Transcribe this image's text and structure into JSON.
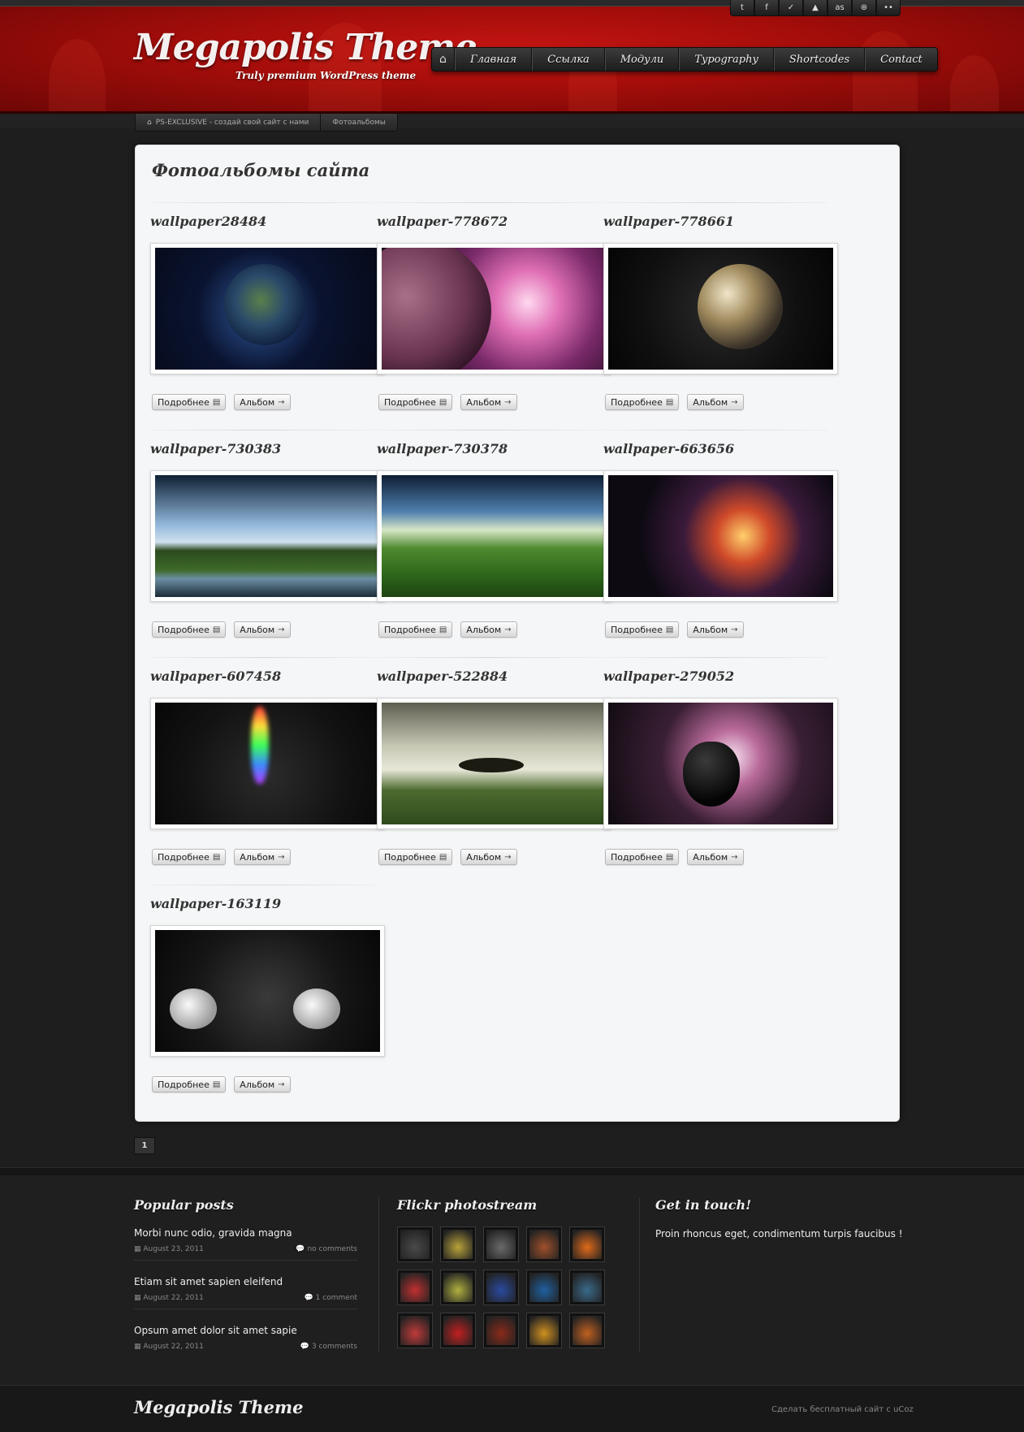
{
  "social": {
    "items": [
      {
        "icon": "tumblr-icon",
        "glyph": "t"
      },
      {
        "icon": "facebook-icon",
        "glyph": "f"
      },
      {
        "icon": "twitter-icon",
        "glyph": "✓"
      },
      {
        "icon": "deviantart-icon",
        "glyph": "▲"
      },
      {
        "icon": "lastfm-icon",
        "glyph": "as"
      },
      {
        "icon": "dribbble-icon",
        "glyph": "⊛"
      },
      {
        "icon": "flickr-icon",
        "glyph": "••"
      }
    ]
  },
  "header": {
    "logo": "Megapolis Theme",
    "tagline": "Truly premium WordPress theme"
  },
  "nav": {
    "home_glyph": "⌂",
    "items": [
      "Главная",
      "Ссылка",
      "Модули",
      "Typography",
      "Shortcodes",
      "Contact"
    ]
  },
  "breadcrumb": {
    "home_glyph": "⌂",
    "site": "PS-EXCLUSIVE - создай свой сайт с нами",
    "current": "Фотоальбомы"
  },
  "main": {
    "title": "Фотоальбомы сайта",
    "more_label": "Подробнее",
    "more_glyph": "▤",
    "album_label": "Альбом",
    "album_glyph": "→",
    "albums": [
      {
        "title": "wallpaper28484"
      },
      {
        "title": "wallpaper-778672"
      },
      {
        "title": "wallpaper-778661"
      },
      {
        "title": "wallpaper-730383"
      },
      {
        "title": "wallpaper-730378"
      },
      {
        "title": "wallpaper-663656"
      },
      {
        "title": "wallpaper-607458"
      },
      {
        "title": "wallpaper-522884"
      },
      {
        "title": "wallpaper-279052"
      },
      {
        "title": "wallpaper-163119"
      }
    ]
  },
  "pagination": {
    "current": "1"
  },
  "footer": {
    "popular": {
      "title": "Popular posts",
      "date_glyph": "▦",
      "comment_glyph": "💬",
      "posts": [
        {
          "title": "Morbi nunc odio, gravida magna",
          "date": "August 23, 2011",
          "comments": "no comments"
        },
        {
          "title": "Etiam sit amet sapien eleifend",
          "date": "August 22, 2011",
          "comments": "1 comment"
        },
        {
          "title": "Opsum amet dolor sit amet sapie",
          "date": "August 22, 2011",
          "comments": "3 comments"
        }
      ]
    },
    "flickr": {
      "title": "Flickr photostream",
      "thumbs": [
        "#4a4a4a",
        "#b8a23a",
        "#6a6a6a",
        "#a0502a",
        "#e06a1a",
        "#c03030",
        "#b0b040",
        "#2a4aa0",
        "#2060a0",
        "#3a6a8a",
        "#c03a3a",
        "#c02020",
        "#8a2a1a",
        "#d09020",
        "#c06020"
      ]
    },
    "contact": {
      "title": "Get in touch!",
      "text": "Proin rhoncus eget, condimentum turpis faucibus !"
    },
    "logo": "Megapolis Theme",
    "copyright": "Сделать бесплатный сайт с uCoz"
  }
}
